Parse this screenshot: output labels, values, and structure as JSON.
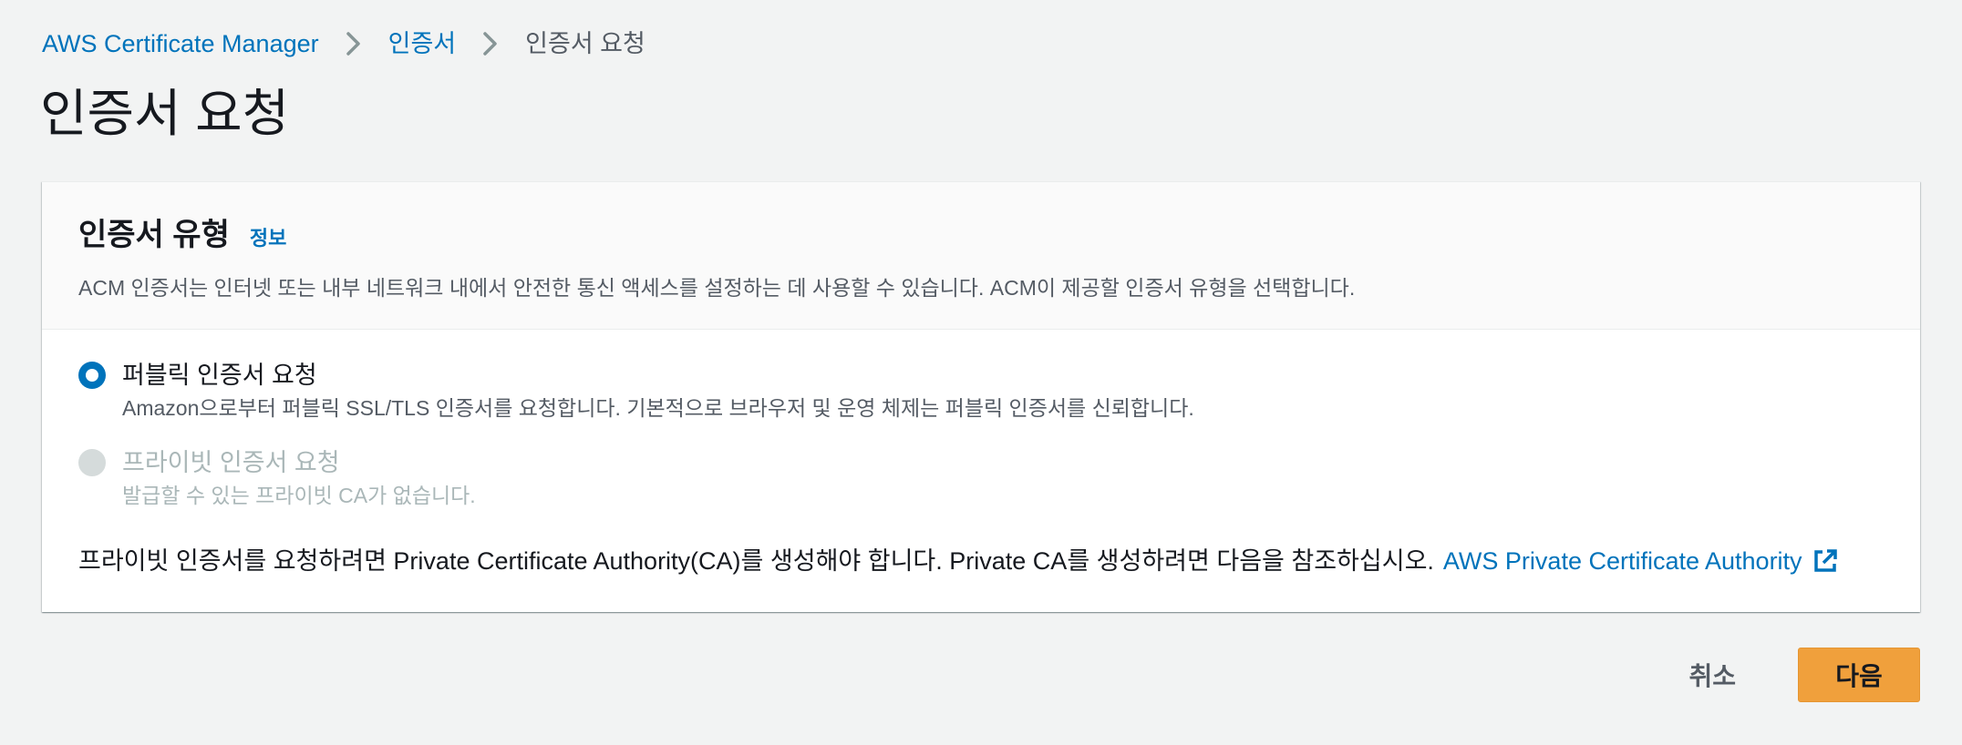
{
  "breadcrumb": {
    "root": "AWS Certificate Manager",
    "parent": "인증서",
    "current": "인증서 요청"
  },
  "page": {
    "title": "인증서 요청"
  },
  "card": {
    "title": "인증서 유형",
    "info": "정보",
    "description": "ACM 인증서는 인터넷 또는 내부 네트워크 내에서 안전한 통신 액세스를 설정하는 데 사용할 수 있습니다. ACM이 제공할 인증서 유형을 선택합니다."
  },
  "options": {
    "public": {
      "label": "퍼블릭 인증서 요청",
      "description": "Amazon으로부터 퍼블릭 SSL/TLS 인증서를 요청합니다. 기본적으로 브라우저 및 운영 체제는 퍼블릭 인증서를 신뢰합니다.",
      "selected": true
    },
    "private": {
      "label": "프라이빗 인증서 요청",
      "description": "발급할 수 있는 프라이빗 CA가 없습니다.",
      "disabled": true
    }
  },
  "note": {
    "text": "프라이빗 인증서를 요청하려면 Private Certificate Authority(CA)를 생성해야 합니다. Private CA를 생성하려면 다음을 참조하십시오.",
    "link_label": "AWS Private Certificate Authority",
    "link_icon": "external-link-icon"
  },
  "actions": {
    "cancel_label": "취소",
    "next_label": "다음"
  },
  "colors": {
    "link": "#0073bb",
    "primary_button": "#f0a03c",
    "background": "#f2f3f3"
  }
}
